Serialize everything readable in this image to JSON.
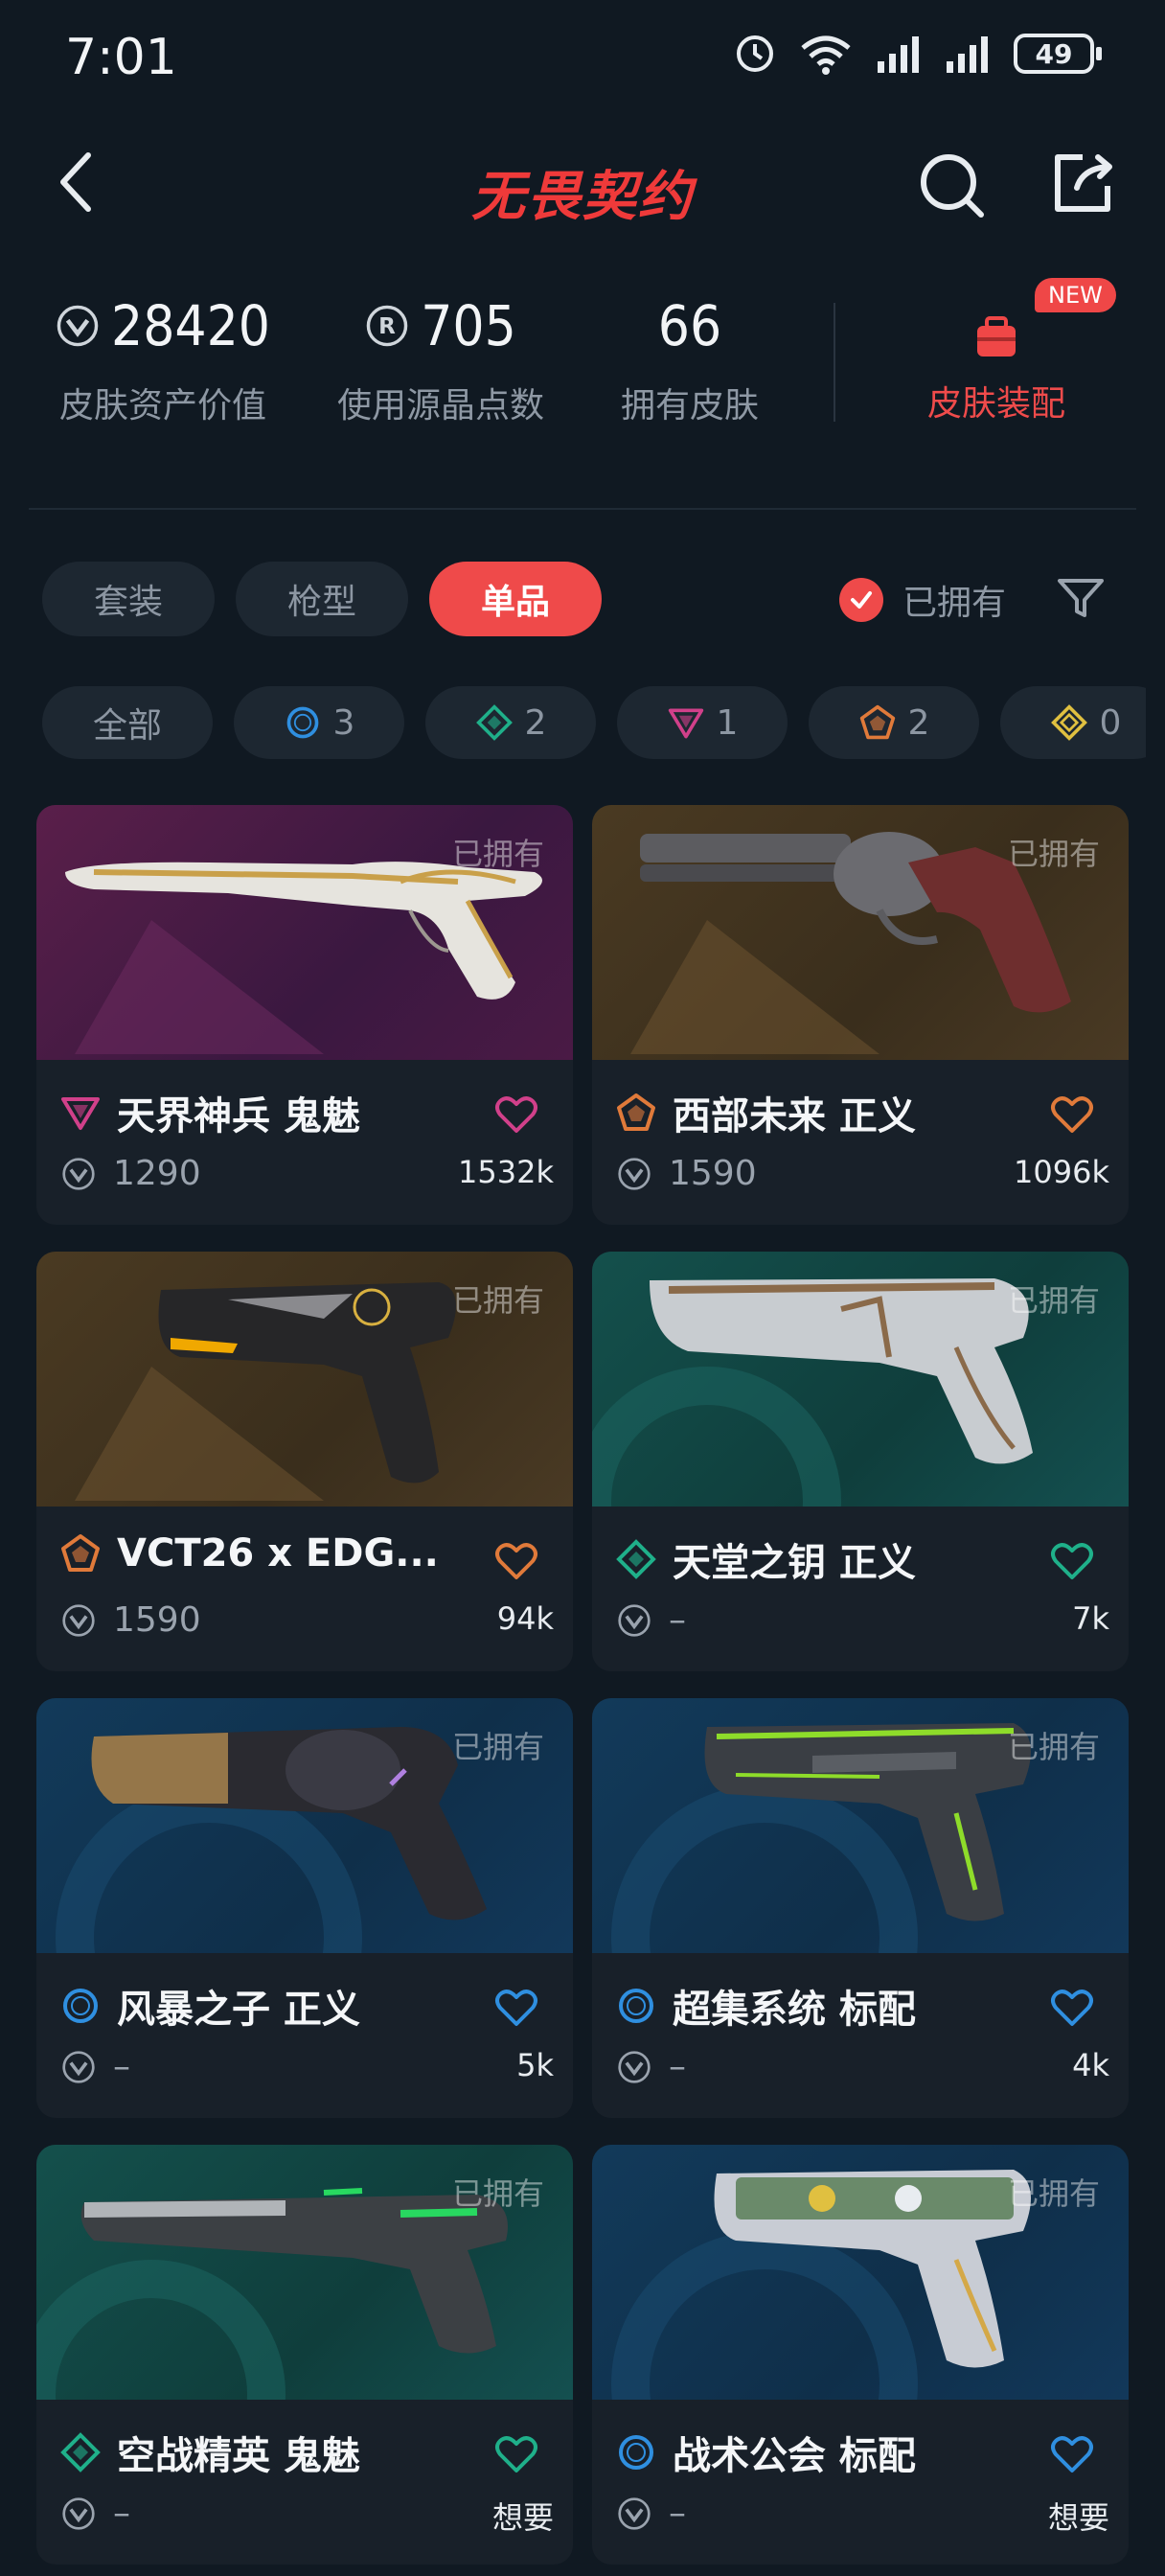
{
  "status": {
    "time": "7:01",
    "battery": "49"
  },
  "header": {
    "title": "无畏契约"
  },
  "stats": {
    "asset_value": "28420",
    "asset_value_label": "皮肤资产价值",
    "radianite": "705",
    "radianite_label": "使用源晶点数",
    "skins_owned": "66",
    "skins_owned_label": "拥有皮肤",
    "loadout_label": "皮肤装配",
    "new_badge": "NEW"
  },
  "tabs": [
    "套装",
    "枪型",
    "单品"
  ],
  "owned_filter_label": "已拥有",
  "chips": [
    {
      "label": "全部",
      "icon": "all",
      "color": "#8c96a2"
    },
    {
      "label": "3",
      "icon": "select-tier-icon",
      "color": "#2f8fe0"
    },
    {
      "label": "2",
      "icon": "deluxe-tier-icon",
      "color": "#1fb08a"
    },
    {
      "label": "1",
      "icon": "premium-tier-icon",
      "color": "#d1408a"
    },
    {
      "label": "2",
      "icon": "exclusive-tier-icon",
      "color": "#e07a3a"
    },
    {
      "label": "0",
      "icon": "ultra-tier-icon",
      "color": "#e0c040"
    }
  ],
  "owned_tag": "已拥有",
  "cards": [
    {
      "name": "天界神兵 鬼魅",
      "price": "1290",
      "likes": "1532k",
      "tier": "premium",
      "tier_color": "#d1408a",
      "bg": "purple"
    },
    {
      "name": "西部未来 正义",
      "price": "1590",
      "likes": "1096k",
      "tier": "exclusive",
      "tier_color": "#e07a3a",
      "bg": "bronze"
    },
    {
      "name": "VCT26 x EDG...",
      "price": "1590",
      "likes": "94k",
      "tier": "exclusive",
      "tier_color": "#e07a3a",
      "bg": "bronze"
    },
    {
      "name": "天堂之钥 正义",
      "price": "–",
      "likes": "7k",
      "tier": "deluxe",
      "tier_color": "#1fb08a",
      "bg": "teal"
    },
    {
      "name": "风暴之子 正义",
      "price": "–",
      "likes": "5k",
      "tier": "select",
      "tier_color": "#2f8fe0",
      "bg": "blue"
    },
    {
      "name": "超集系统 标配",
      "price": "–",
      "likes": "4k",
      "tier": "select",
      "tier_color": "#2f8fe0",
      "bg": "blue"
    },
    {
      "name": "空战精英 鬼魅",
      "price": "–",
      "likes": "想要",
      "tier": "deluxe",
      "tier_color": "#1fb08a",
      "bg": "teal"
    },
    {
      "name": "战术公会 标配",
      "price": "–",
      "likes": "想要",
      "tier": "select",
      "tier_color": "#2f8fe0",
      "bg": "blue"
    }
  ]
}
